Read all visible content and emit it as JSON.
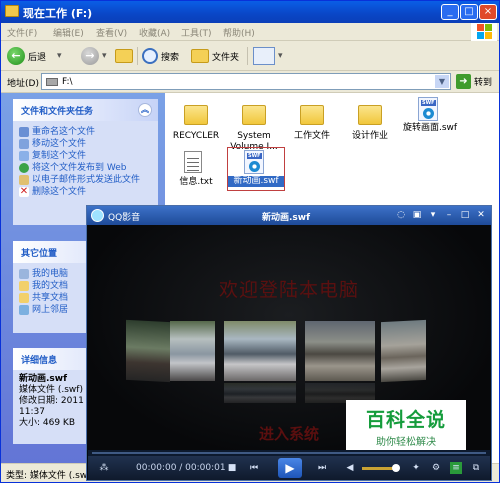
{
  "window": {
    "title": "现在工作 (F:)"
  },
  "menu": [
    "文件(F)",
    "编辑(E)",
    "查看(V)",
    "收藏(A)",
    "工具(T)",
    "帮助(H)"
  ],
  "toolbar": {
    "back": "后退",
    "search": "搜索",
    "folders": "文件夹"
  },
  "address": {
    "label": "地址(D)",
    "value": "F:\\",
    "go": "转到"
  },
  "tasks_panel": {
    "title": "文件和文件夹任务",
    "items": [
      "重命名这个文件",
      "移动这个文件",
      "复制这个文件",
      "将这个文件发布到 Web",
      "以电子邮件形式发送此文件",
      "删除这个文件"
    ]
  },
  "places_panel": {
    "title": "其它位置",
    "items": [
      "我的电脑",
      "我的文档",
      "共享文档",
      "网上邻居"
    ]
  },
  "details_panel": {
    "title": "详细信息",
    "name": "新动画.swf",
    "type": "媒体文件 (.swf)",
    "modified": "修改日期: 2011",
    "time": "11:37",
    "size": "大小: 469 KB"
  },
  "files": [
    {
      "name": "RECYCLER",
      "kind": "folder"
    },
    {
      "name": "System Volume I...",
      "kind": "folder"
    },
    {
      "name": "工作文件",
      "kind": "folder"
    },
    {
      "name": "设计作业",
      "kind": "folder"
    },
    {
      "name": "旋转画面.swf",
      "kind": "swf"
    },
    {
      "name": "信息.txt",
      "kind": "txt"
    },
    {
      "name": "新动画.swf",
      "kind": "swf",
      "selected": true
    }
  ],
  "status": "类型: 媒体文件 (.sw",
  "player": {
    "app_name": "QQ影音",
    "file_title": "新动画.swf",
    "video_heading": "欢迎登陆本电脑",
    "video_button": "进入系统",
    "time": "00:00:00 / 00:00:01"
  },
  "watermark": {
    "main": "百科全说",
    "sub": "助你轻松解决"
  }
}
